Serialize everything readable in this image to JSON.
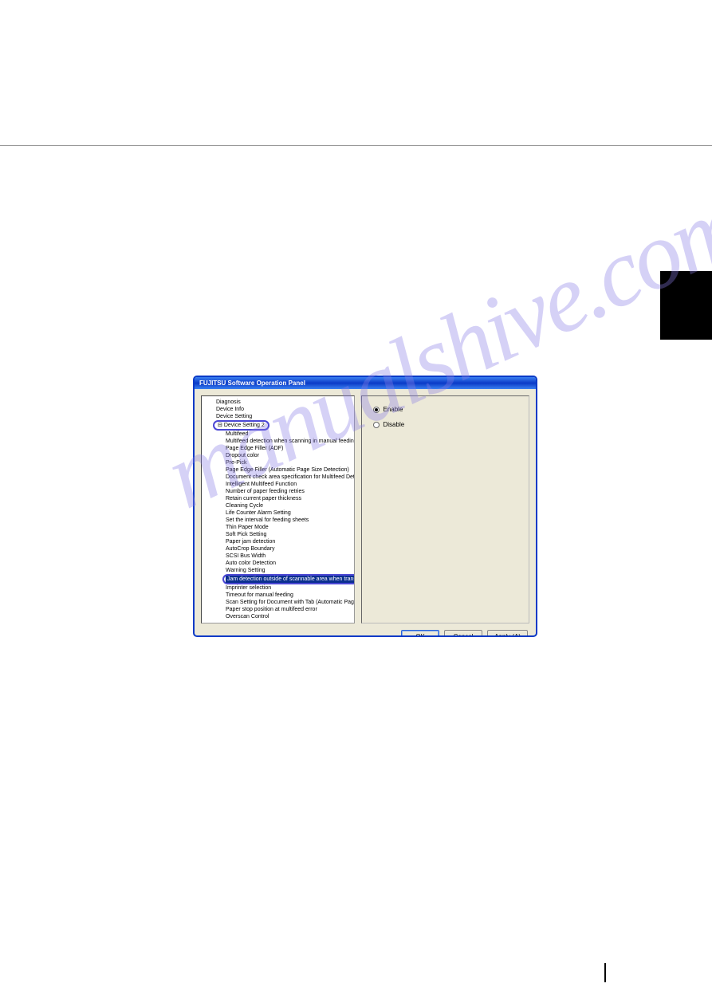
{
  "dialog": {
    "title": "FUJITSU Software Operation Panel",
    "buttons": {
      "ok": "OK",
      "cancel": "Cancel",
      "apply": "Apply (A)"
    }
  },
  "tree": {
    "root": {
      "diagnosis": "Diagnosis",
      "device_info": "Device Info",
      "device_setting": "Device Setting",
      "device_setting2": "Device Setting 2"
    },
    "items": [
      "Multifeed",
      "Multifeed detection when scanning in manual feeding mode",
      "Page Edge Filler (ADF)",
      "Dropout color",
      "Pre-Pick",
      "Page Edge Filler (Automatic Page Size Detection)",
      "Document check area specification for Multifeed Detection",
      "Intelligent Multifeed Function",
      "Number of paper feeding retries",
      "Retain current paper thickness",
      "Cleaning Cycle",
      "Life Counter Alarm Setting",
      "Set the interval for feeding sheets",
      "Thin Paper Mode",
      "Soft Pick Setting",
      "Paper jam detection",
      "AutoCrop Boundary",
      "SCSI Bus Width",
      "Auto color Detection",
      "Warning Setting",
      "Jam detection outside of scannable area when transporting paper",
      "Imprinter selection",
      "Timeout for manual feeding",
      "Scan Setting for Document with Tab (Automatic Page Size Detection)",
      "Paper stop position at multifeed error",
      "Overscan Control"
    ]
  },
  "options": {
    "enable": "Enable",
    "disable": "Disable"
  },
  "watermark": "manualshive.com"
}
